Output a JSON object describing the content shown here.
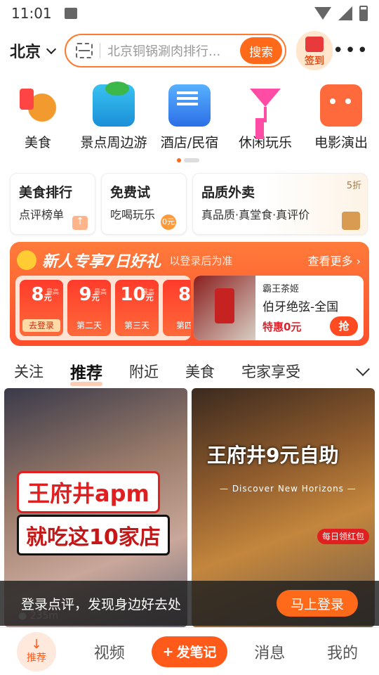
{
  "status_bar": {
    "time": "11:01"
  },
  "header": {
    "city": "北京",
    "search_placeholder": "北京铜锅涮肉排行...",
    "search_button": "搜索",
    "signin_label": "签到"
  },
  "categories": [
    {
      "label": "美食",
      "icon": "food-icon"
    },
    {
      "label": "景点周边游",
      "icon": "palm-tree-icon"
    },
    {
      "label": "酒店/民宿",
      "icon": "hotel-icon"
    },
    {
      "label": "休闲玩乐",
      "icon": "cocktail-icon"
    },
    {
      "label": "电影演出",
      "icon": "cat-face-icon"
    }
  ],
  "promo_cards": [
    {
      "title": "美食排行",
      "subtitle": "点评榜单"
    },
    {
      "title": "免费试",
      "subtitle": "吃喝玩乐",
      "badge": "0元"
    },
    {
      "title": "品质外卖",
      "subtitle": "真品质·真堂食·真评价",
      "tag": "5折"
    }
  ],
  "new_user_banner": {
    "title": "新人专享7日好礼",
    "note": "以登录后为准",
    "see_more": "查看更多",
    "coupons": [
      {
        "amount": "8",
        "unit": "元",
        "cap": "最高",
        "day": "去登录"
      },
      {
        "amount": "9",
        "unit": "元",
        "cap": "最高",
        "day": "第二天"
      },
      {
        "amount": "10",
        "unit": "元",
        "cap": "最高",
        "day": "第三天"
      },
      {
        "amount": "8",
        "unit": "",
        "cap": "",
        "day": "第四"
      }
    ],
    "deal": {
      "brand": "霸王茶姬",
      "name": "伯牙绝弦-全国",
      "price": "特惠0元",
      "button": "抢"
    }
  },
  "tabs": [
    "关注",
    "推荐",
    "附近",
    "美食",
    "宅家享受"
  ],
  "active_tab": "推荐",
  "posts": [
    {
      "line1": "王府井apm",
      "line2": "就吃这10家店",
      "distance": "235m"
    },
    {
      "line1": "王府井9元自助",
      "line2": "— Discover New Horizons —",
      "badge": "每日领红包"
    }
  ],
  "login_bar": {
    "message": "登录点评，发现身边好去处",
    "button": "马上登录"
  },
  "bottom_nav": {
    "home": "推荐",
    "video": "视频",
    "post": "发笔记",
    "messages": "消息",
    "me": "我的"
  },
  "colors": {
    "accent": "#ff6a1a",
    "banner": "#ff5a2c"
  }
}
